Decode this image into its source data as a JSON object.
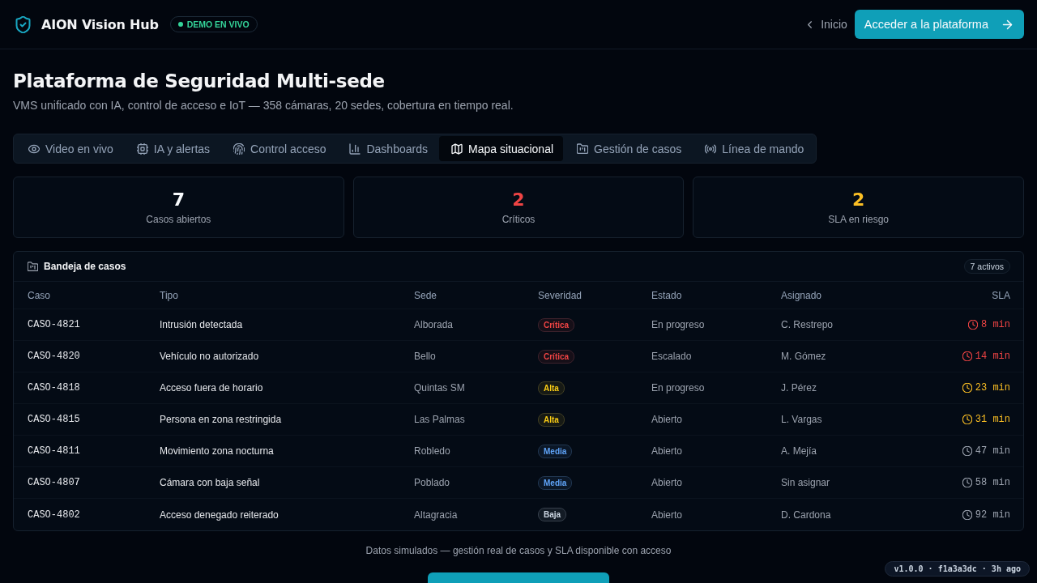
{
  "header": {
    "brand": "AION Vision Hub",
    "live_badge": "DEMO EN VIVO",
    "back_link": "Inicio",
    "cta_button": "Acceder a la plataforma"
  },
  "page": {
    "title": "Plataforma de Seguridad Multi-sede",
    "subtitle": "VMS unificado con IA, control de acceso e IoT — 358 cámaras, 20 sedes, cobertura en tiempo real."
  },
  "tabs": [
    {
      "label": "Video en vivo",
      "selected": false
    },
    {
      "label": "IA y alertas",
      "selected": false
    },
    {
      "label": "Control acceso",
      "selected": false
    },
    {
      "label": "Dashboards",
      "selected": false
    },
    {
      "label": "Mapa situacional",
      "selected": true
    },
    {
      "label": "Gestión de casos",
      "selected": false
    },
    {
      "label": "Línea de mando",
      "selected": false
    }
  ],
  "stats": [
    {
      "value": "7",
      "label": "Casos abiertos",
      "color": "#f8fafc"
    },
    {
      "value": "2",
      "label": "Críticos",
      "color": "#ef4444"
    },
    {
      "value": "2",
      "label": "SLA en riesgo",
      "color": "#fbbf24"
    }
  ],
  "cases": {
    "title": "Bandeja de casos",
    "count_badge": "7 activos",
    "columns": [
      "Caso",
      "Tipo",
      "Sede",
      "Severidad",
      "Estado",
      "Asignado",
      "SLA"
    ],
    "rows": [
      {
        "case": "CASO-4821",
        "type": "Intrusión detectada",
        "site": "Alborada",
        "severity": {
          "label": "Crítica",
          "color": "#ef4444"
        },
        "status": "En progreso",
        "assignee": "C. Restrepo",
        "sla": {
          "text": "8 min",
          "color": "#ef4444"
        }
      },
      {
        "case": "CASO-4820",
        "type": "Vehículo no autorizado",
        "site": "Bello",
        "severity": {
          "label": "Crítica",
          "color": "#ef4444"
        },
        "status": "Escalado",
        "assignee": "M. Gómez",
        "sla": {
          "text": "14 min",
          "color": "#ef4444"
        }
      },
      {
        "case": "CASO-4818",
        "type": "Acceso fuera de horario",
        "site": "Quintas SM",
        "severity": {
          "label": "Alta",
          "color": "#facc15"
        },
        "status": "En progreso",
        "assignee": "J. Pérez",
        "sla": {
          "text": "23 min",
          "color": "#fbbf24"
        }
      },
      {
        "case": "CASO-4815",
        "type": "Persona en zona restringida",
        "site": "Las Palmas",
        "severity": {
          "label": "Alta",
          "color": "#facc15"
        },
        "status": "Abierto",
        "assignee": "L. Vargas",
        "sla": {
          "text": "31 min",
          "color": "#fbbf24"
        }
      },
      {
        "case": "CASO-4811",
        "type": "Movimiento zona nocturna",
        "site": "Robledo",
        "severity": {
          "label": "Media",
          "color": "#60a5fa"
        },
        "status": "Abierto",
        "assignee": "A. Mejía",
        "sla": {
          "text": "47 min",
          "color": "#9ca3af"
        }
      },
      {
        "case": "CASO-4807",
        "type": "Cámara con baja señal",
        "site": "Poblado",
        "severity": {
          "label": "Media",
          "color": "#60a5fa"
        },
        "status": "Abierto",
        "assignee": "Sin asignar",
        "sla": {
          "text": "58 min",
          "color": "#9ca3af"
        }
      },
      {
        "case": "CASO-4802",
        "type": "Acceso denegado reiterado",
        "site": "Altagracia",
        "severity": {
          "label": "Baja",
          "color": "#cbd5e1"
        },
        "status": "Abierto",
        "assignee": "D. Cardona",
        "sla": {
          "text": "92 min",
          "color": "#9ca3af"
        }
      }
    ]
  },
  "footer": {
    "note": "Datos simulados — gestión real de casos y SLA disponible con acceso",
    "cut_off_button": true,
    "version_badge": "v1.0.0 · f1a3a3dc · 3h ago"
  }
}
